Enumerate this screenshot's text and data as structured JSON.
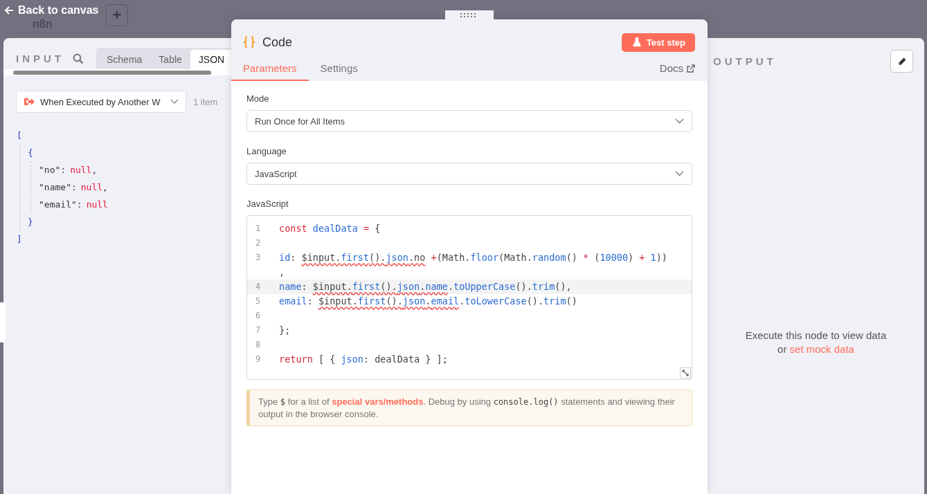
{
  "top_bar": {
    "back": "Back to canvas",
    "logo": "n8n",
    "add": "+"
  },
  "input": {
    "title": "INPUT",
    "tabs": [
      {
        "label": "Schema",
        "selected": false
      },
      {
        "label": "Table",
        "selected": false
      },
      {
        "label": "JSON",
        "selected": true
      }
    ],
    "source": "When Executed by Another W",
    "count": "1 item",
    "json": {
      "open": "[",
      "object_open": "{",
      "fields": [
        {
          "key": "\"no\":",
          "value": "null",
          "sep": ","
        },
        {
          "key": "\"name\":",
          "value": "null",
          "sep": ","
        },
        {
          "key": "\"email\":",
          "value": "null"
        }
      ],
      "object_close": "}",
      "close": "]"
    }
  },
  "node": {
    "title": "Code",
    "test_button": "Test step",
    "tabs": [
      {
        "label": "Parameters",
        "selected": true
      },
      {
        "label": "Settings",
        "selected": false
      }
    ],
    "docs": "Docs",
    "fields": [
      {
        "label": "Mode",
        "value": "Run Once for All Items"
      },
      {
        "label": "Language",
        "value": "JavaScript"
      }
    ],
    "editor_label": "JavaScript",
    "code": [
      {
        "num": "1",
        "active": false,
        "tokens": [
          {
            "t": "const ",
            "kind": "kw"
          },
          {
            "t": "dealData",
            "kind": "var"
          },
          {
            "t": " = ",
            "kind": "op"
          },
          {
            "t": "{",
            "kind": "text"
          }
        ]
      },
      {
        "num": "2",
        "active": false
      },
      {
        "num": "3",
        "active": false,
        "tokens": [
          {
            "t": "id",
            "kind": "var"
          },
          {
            "t": ": ",
            "kind": "text"
          },
          {
            "t": "$input.",
            "kind": "err"
          },
          {
            "t": "first",
            "kind": "errvar"
          },
          {
            "t": "().",
            "kind": "err"
          },
          {
            "t": "json",
            "kind": "errvar"
          },
          {
            "t": ".no",
            "kind": "err"
          },
          {
            "t": " +",
            "kind": "op"
          },
          {
            "t": "(Math.",
            "kind": "text"
          },
          {
            "t": "floor",
            "kind": "var"
          },
          {
            "t": "(Math.",
            "kind": "text"
          },
          {
            "t": "random",
            "kind": "var"
          },
          {
            "t": "() ",
            "kind": "text"
          },
          {
            "t": "*",
            "kind": "op"
          },
          {
            "t": " (",
            "kind": "text"
          },
          {
            "t": "10000",
            "kind": "num"
          },
          {
            "t": ") ",
            "kind": "text"
          },
          {
            "t": "+ ",
            "kind": "op"
          },
          {
            "t": "1",
            "kind": "num"
          },
          {
            "t": ")) ,",
            "kind": "text"
          }
        ]
      },
      {
        "num": "4",
        "active": true,
        "tokens": [
          {
            "t": "name",
            "kind": "var"
          },
          {
            "t": ": ",
            "kind": "text"
          },
          {
            "t": "$input.",
            "kind": "err"
          },
          {
            "t": "first",
            "kind": "errvar"
          },
          {
            "t": "().",
            "kind": "err"
          },
          {
            "t": "json",
            "kind": "errvar"
          },
          {
            "t": ".",
            "kind": "err"
          },
          {
            "t": "name",
            "kind": "errvar"
          },
          {
            "t": ".",
            "kind": "text"
          },
          {
            "t": "toUpperCase",
            "kind": "var"
          },
          {
            "t": "().",
            "kind": "text"
          },
          {
            "t": "trim",
            "kind": "var"
          },
          {
            "t": "(),",
            "kind": "text"
          }
        ]
      },
      {
        "num": "5",
        "active": false,
        "tokens": [
          {
            "t": "email",
            "kind": "var"
          },
          {
            "t": ": ",
            "kind": "text"
          },
          {
            "t": "$input.",
            "kind": "err"
          },
          {
            "t": "first",
            "kind": "errvar"
          },
          {
            "t": "().",
            "kind": "err"
          },
          {
            "t": "json",
            "kind": "errvar"
          },
          {
            "t": ".",
            "kind": "err"
          },
          {
            "t": "email",
            "kind": "errvar"
          },
          {
            "t": ".",
            "kind": "text"
          },
          {
            "t": "toLowerCase",
            "kind": "var"
          },
          {
            "t": "().",
            "kind": "text"
          },
          {
            "t": "trim",
            "kind": "var"
          },
          {
            "t": "()",
            "kind": "text"
          }
        ]
      },
      {
        "num": "6",
        "active": false
      },
      {
        "num": "7",
        "active": false,
        "tokens": [
          {
            "t": "};",
            "kind": "text"
          }
        ]
      },
      {
        "num": "8",
        "active": false
      },
      {
        "num": "9",
        "active": false,
        "tokens": [
          {
            "t": "return",
            "kind": "kw"
          },
          {
            "t": " [ { ",
            "kind": "text"
          },
          {
            "t": "json",
            "kind": "var"
          },
          {
            "t": ": dealData } ];",
            "kind": "text"
          }
        ]
      }
    ],
    "notice": {
      "pre": "Type",
      "dollar": "$",
      "mid": "for a list of",
      "link": "special vars/methods",
      "after": ". Debug by using",
      "code": "console.log()",
      "post": "statements and viewing their output in the browser console."
    }
  },
  "output": {
    "title": "OUTPUT",
    "empty": "Execute this node to view data",
    "or": "or",
    "link": "set mock data"
  }
}
